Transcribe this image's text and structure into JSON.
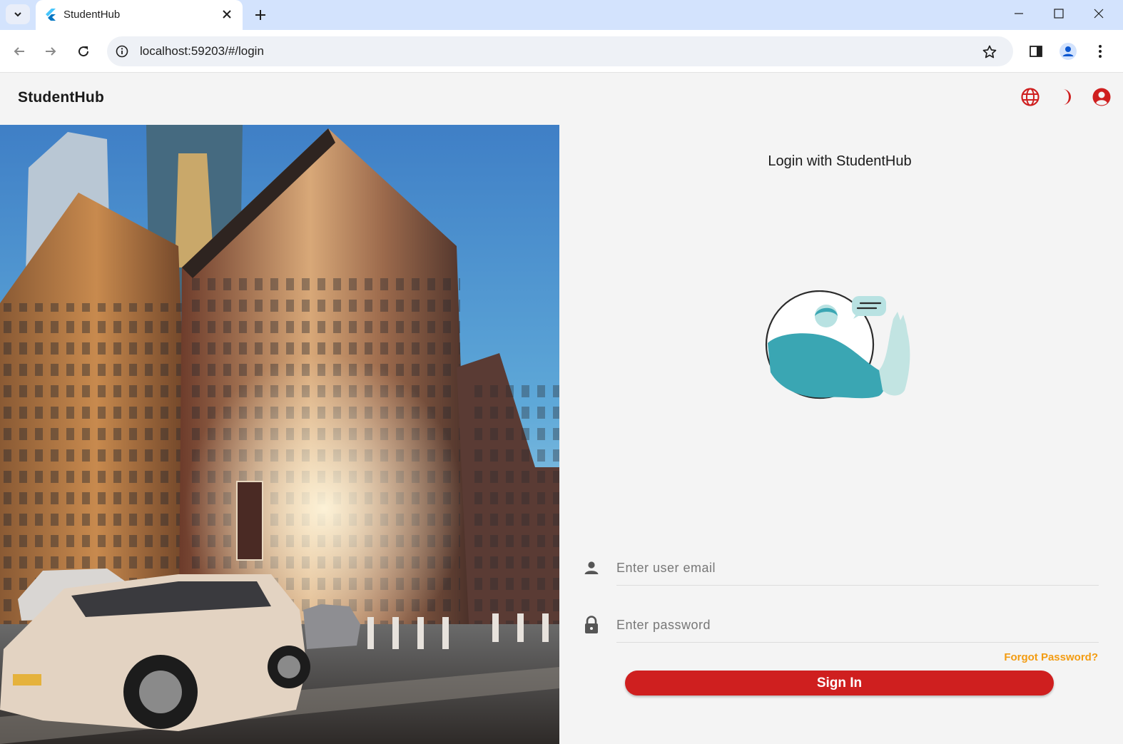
{
  "browser": {
    "tab_title": "StudentHub",
    "url": "localhost:59203/#/login"
  },
  "header": {
    "brand": "StudentHub",
    "icons": [
      "globe-icon",
      "moon-icon",
      "account-icon"
    ],
    "accent_color": "#cf1f1f"
  },
  "login": {
    "title": "Login with StudentHub",
    "email_placeholder": "Enter user email",
    "password_placeholder": "Enter password",
    "forgot_label": "Forgot Password?",
    "signin_label": "Sign In"
  },
  "colors": {
    "primary": "#cf1f1f",
    "link": "#f39c12",
    "background": "#f4f4f4",
    "illustration": "#3aa6b3"
  }
}
